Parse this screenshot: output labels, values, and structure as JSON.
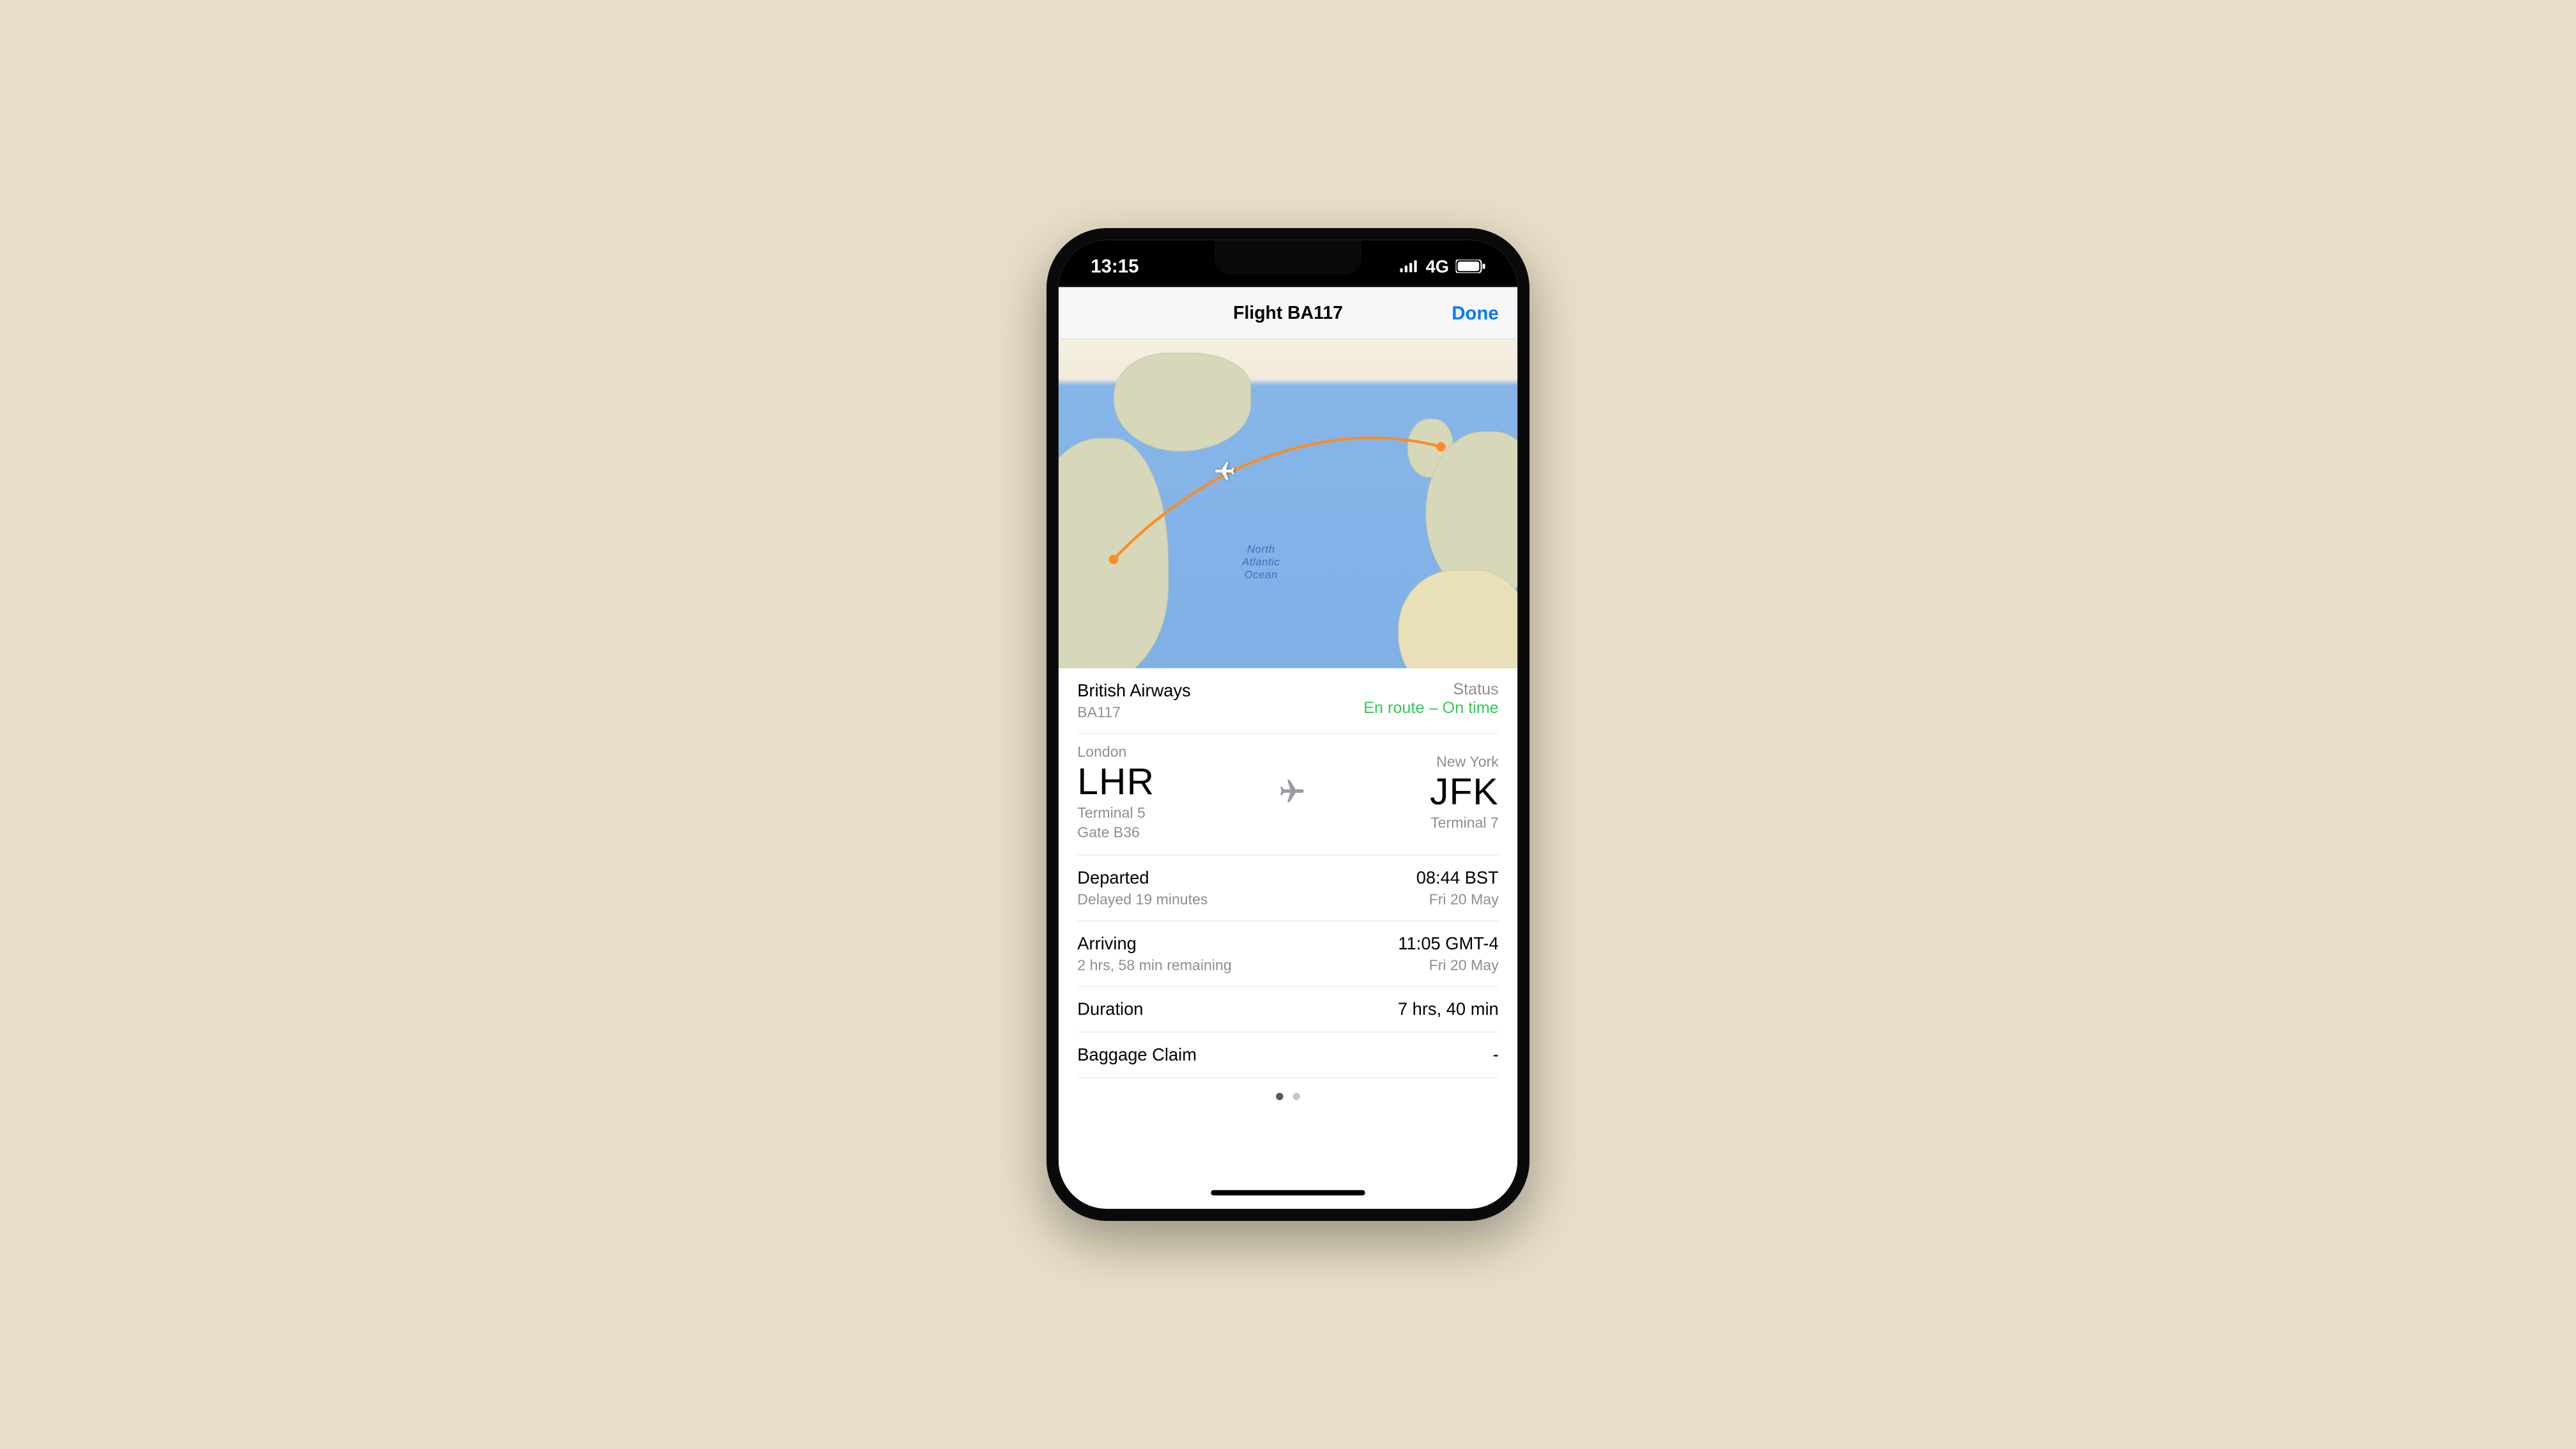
{
  "status_bar": {
    "time": "13:15",
    "network": "4G"
  },
  "header": {
    "title": "Flight BA117",
    "done_label": "Done"
  },
  "map": {
    "ocean_label": "North\nAtlantic\nOcean"
  },
  "airline": {
    "name": "British Airways",
    "flight_number": "BA117",
    "status_label": "Status",
    "status_value": "En route – On time"
  },
  "origin": {
    "city": "London",
    "code": "LHR",
    "terminal": "Terminal 5",
    "gate": "Gate B36"
  },
  "destination": {
    "city": "New York",
    "code": "JFK",
    "terminal": "Terminal 7"
  },
  "departed": {
    "label": "Departed",
    "delay": "Delayed 19 minutes",
    "time": "08:44 BST",
    "date": "Fri 20 May"
  },
  "arriving": {
    "label": "Arriving",
    "remaining": "2 hrs, 58 min remaining",
    "time": "11:05 GMT-4",
    "date": "Fri 20 May"
  },
  "duration": {
    "label": "Duration",
    "value": "7 hrs, 40 min"
  },
  "baggage": {
    "label": "Baggage Claim",
    "value": "-"
  }
}
